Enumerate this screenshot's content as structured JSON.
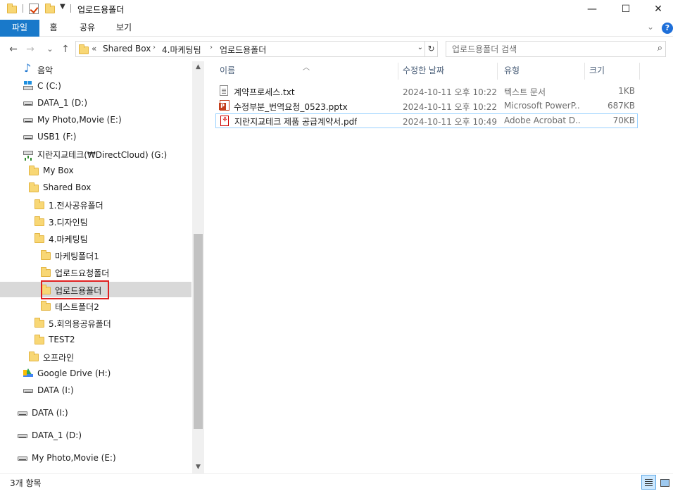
{
  "window": {
    "title": "업로드용폴더",
    "controls": {
      "minimize": "—",
      "maximize": "☐",
      "close": "✕"
    }
  },
  "ribbon": {
    "tabs": [
      {
        "label": "파일"
      },
      {
        "label": "홈"
      },
      {
        "label": "공유"
      },
      {
        "label": "보기"
      }
    ],
    "expand_icon": "chevron-down-icon",
    "help_label": "?"
  },
  "navigation": {
    "back_icon": "←",
    "forward_icon": "→",
    "recent_icon": "⌄",
    "up_icon": "↑",
    "breadcrumb": {
      "overflow": "«",
      "items": [
        "Shared Box",
        "4.마케팅팀",
        "업로드용폴더"
      ],
      "separator": "›"
    },
    "refresh_icon": "↻"
  },
  "search": {
    "placeholder": "업로드용폴더 검색",
    "value": ""
  },
  "nav_tree": [
    {
      "label": "음악",
      "icon": "music-icon",
      "level": 0
    },
    {
      "label": "C (C:)",
      "icon": "windows-drive-icon",
      "level": 0
    },
    {
      "label": "DATA_1 (D:)",
      "icon": "drive-icon",
      "level": 0
    },
    {
      "label": "My Photo,Movie (E:)",
      "icon": "drive-icon",
      "level": 0
    },
    {
      "label": "USB1 (F:)",
      "icon": "drive-icon",
      "level": 0
    },
    {
      "label": "지란지교테크(₩DirectCloud) (G:)",
      "icon": "network-drive-icon",
      "level": 0
    },
    {
      "label": "My Box",
      "icon": "folder-icon",
      "level": 1
    },
    {
      "label": "Shared Box",
      "icon": "folder-icon",
      "level": 1
    },
    {
      "label": "1.전사공유폴더",
      "icon": "folder-icon",
      "level": 2
    },
    {
      "label": "3.디자인팀",
      "icon": "folder-icon",
      "level": 2
    },
    {
      "label": "4.마케팅팀",
      "icon": "folder-icon",
      "level": 2
    },
    {
      "label": "마케팅폴더1",
      "icon": "folder-icon",
      "level": 3
    },
    {
      "label": "업로드요청폴더",
      "icon": "folder-icon",
      "level": 3
    },
    {
      "label": "업로드용폴더",
      "icon": "folder-icon",
      "level": 3,
      "selected": true
    },
    {
      "label": "테스트폴더2",
      "icon": "folder-icon",
      "level": 3
    },
    {
      "label": "5.회의용공유폴더",
      "icon": "folder-icon",
      "level": 2
    },
    {
      "label": "TEST2",
      "icon": "folder-icon",
      "level": 2
    },
    {
      "label": "오프라인",
      "icon": "folder-icon",
      "level": 1
    },
    {
      "label": "Google Drive (H:)",
      "icon": "google-drive-icon",
      "level": 0
    },
    {
      "label": "DATA (I:)",
      "icon": "drive-icon",
      "level": 0
    },
    {
      "label": "DATA (I:)",
      "icon": "drive-icon",
      "level": -1
    },
    {
      "label": "DATA_1 (D:)",
      "icon": "drive-icon",
      "level": -1
    },
    {
      "label": "My Photo,Movie (E:)",
      "icon": "drive-icon",
      "level": -1
    }
  ],
  "file_list": {
    "columns": [
      {
        "label": "이름"
      },
      {
        "label": "수정한 날짜"
      },
      {
        "label": "유형"
      },
      {
        "label": "크기"
      }
    ],
    "rows": [
      {
        "name": "계약프로세스.txt",
        "date": "2024-10-11 오후 10:22",
        "type": "텍스트 문서",
        "size": "1KB",
        "icon": "text-file-icon"
      },
      {
        "name": "수정부분_번역요청_0523.pptx",
        "date": "2024-10-11 오후 10:22",
        "type": "Microsoft PowerP...",
        "size": "687KB",
        "icon": "powerpoint-file-icon"
      },
      {
        "name": "지란지교테크 제품 공급계약서.pdf",
        "date": "2024-10-11 오후 10:49",
        "type": "Adobe Acrobat D...",
        "size": "70KB",
        "icon": "pdf-file-icon"
      }
    ]
  },
  "status_bar": {
    "item_count": "3개 항목"
  },
  "colors": {
    "accent": "#1979ca",
    "selection": "#d9d9d9",
    "highlight_box": "#e02020",
    "folder": "#f8d775"
  }
}
